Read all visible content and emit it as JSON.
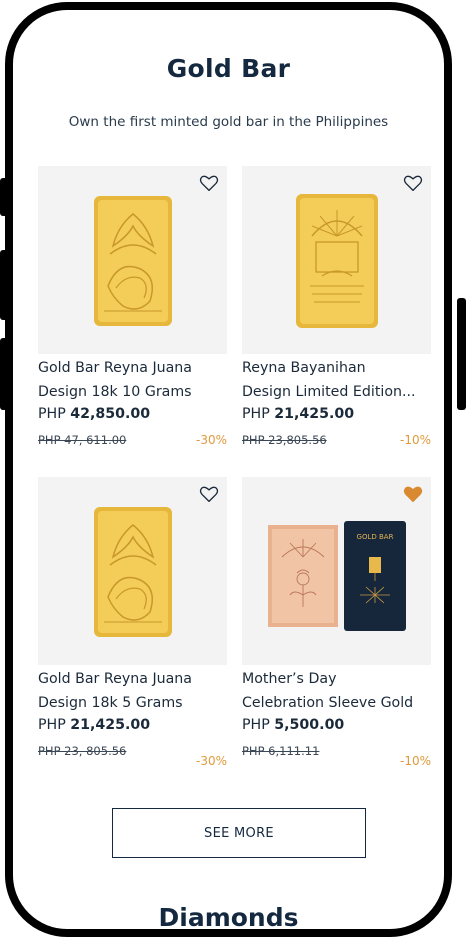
{
  "page": {
    "title": "Gold Bar",
    "subtitle": "Own the first minted gold bar in the Philippines"
  },
  "products": [
    {
      "name_line1": "Gold Bar Reyna Juana",
      "name_line2": "Design 18k 10 Grams",
      "currency": "PHP",
      "price": "42,850.00",
      "old_price": "PHP 47, 611.00",
      "discount": "-30%",
      "favorited": false,
      "image": "gold-bar-reyna-juana"
    },
    {
      "name_line1": "Reyna Bayanihan",
      "name_line2": "Design Limited Edition...",
      "currency": "PHP",
      "price": "21,425.00",
      "old_price": "PHP 23,805.56",
      "discount": "-10%",
      "favorited": false,
      "image": "gold-bar-reyna-bayanihan"
    },
    {
      "name_line1": "Gold Bar Reyna Juana",
      "name_line2": "Design 18k 5 Grams",
      "currency": "PHP",
      "price": "21,425.00",
      "old_price": "PHP 23, 805.56",
      "discount": "-30%",
      "favorited": false,
      "image": "gold-bar-reyna-juana"
    },
    {
      "name_line1": "Mother’s Day",
      "name_line2": "Celebration Sleeve Gold",
      "currency": "PHP",
      "price": "5,500.00",
      "old_price": "PHP 6,111.11",
      "discount": "-10%",
      "favorited": true,
      "image": "mothers-day-sleeve",
      "sleeve_label": "GOLD BAR"
    }
  ],
  "see_more_label": "SEE MORE",
  "next_section_title": "Diamonds",
  "colors": {
    "heading": "#14293f",
    "discount": "#e09a3d",
    "heart_active": "#d98a30",
    "gold": "#f0c64a"
  }
}
